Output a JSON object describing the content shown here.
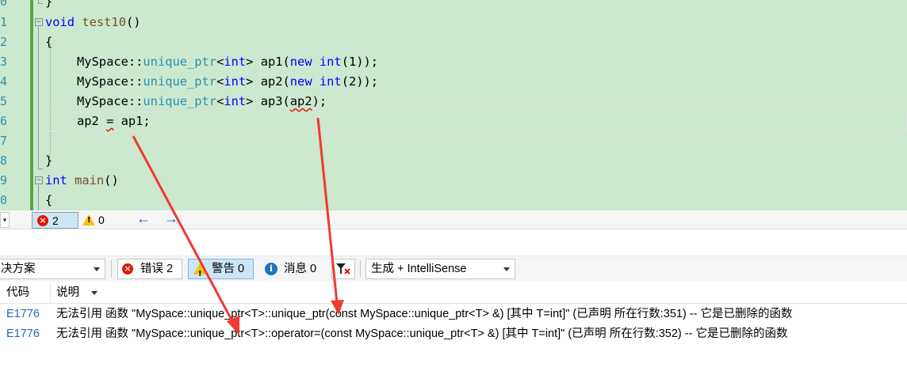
{
  "editor": {
    "line_numbers": [
      "0",
      "1",
      "2",
      "3",
      "4",
      "5",
      "6",
      "7",
      "8",
      "9",
      "0"
    ],
    "lines": {
      "l0": "}",
      "l1_kw": "void",
      "l1_fn": "test10",
      "l1_rest": "()",
      "l2": "{",
      "l3_ns": "MySpace::",
      "l3_ty": "unique_ptr",
      "l3_lt": "<",
      "l3_int": "int",
      "l3_gt": "> ap1(",
      "l3_new": "new",
      "l3_int2": "int",
      "l3_end": "(1));",
      "l4_ns": "MySpace::",
      "l4_ty": "unique_ptr",
      "l4_lt": "<",
      "l4_int": "int",
      "l4_gt": "> ap2(",
      "l4_new": "new",
      "l4_int2": "int",
      "l4_end": "(2));",
      "l5_ns": "MySpace::",
      "l5_ty": "unique_ptr",
      "l5_lt": "<",
      "l5_int": "int",
      "l5_gt": "> ap3(",
      "l5_arg": "ap2",
      "l5_end": ");",
      "l6_a": "ap2 ",
      "l6_op": "=",
      "l6_b": " ap1;",
      "l8": "}",
      "l9_kw": "int",
      "l9_fn": "main",
      "l9_rest": "()",
      "l10": "{"
    }
  },
  "strip": {
    "error_count": "2",
    "warning_count": "0",
    "nav_back": "←",
    "nav_forward": "→"
  },
  "toolbar": {
    "scope": "决方案",
    "errors_label": "错误 2",
    "warnings_label": "警告 0",
    "messages_label": "消息 0",
    "build_filter": "生成 + IntelliSense"
  },
  "columns": {
    "code": "代码",
    "description": "说明"
  },
  "errors": [
    {
      "code": "E1776",
      "description": "无法引用 函数 \"MySpace::unique_ptr<T>::unique_ptr(const MySpace::unique_ptr<T> &) [其中 T=int]\" (已声明 所在行数:351) -- 它是已删除的函数"
    },
    {
      "code": "E1776",
      "description": "无法引用 函数 \"MySpace::unique_ptr<T>::operator=(const MySpace::unique_ptr<T> &) [其中 T=int]\" (已声明 所在行数:352) -- 它是已删除的函数"
    }
  ],
  "colors": {
    "editor_bg": "#cce8cf",
    "keyword": "#0000ff",
    "type": "#2b91af",
    "function": "#74531f",
    "error": "#e51400",
    "annotation_arrow": "#ee3a32"
  }
}
